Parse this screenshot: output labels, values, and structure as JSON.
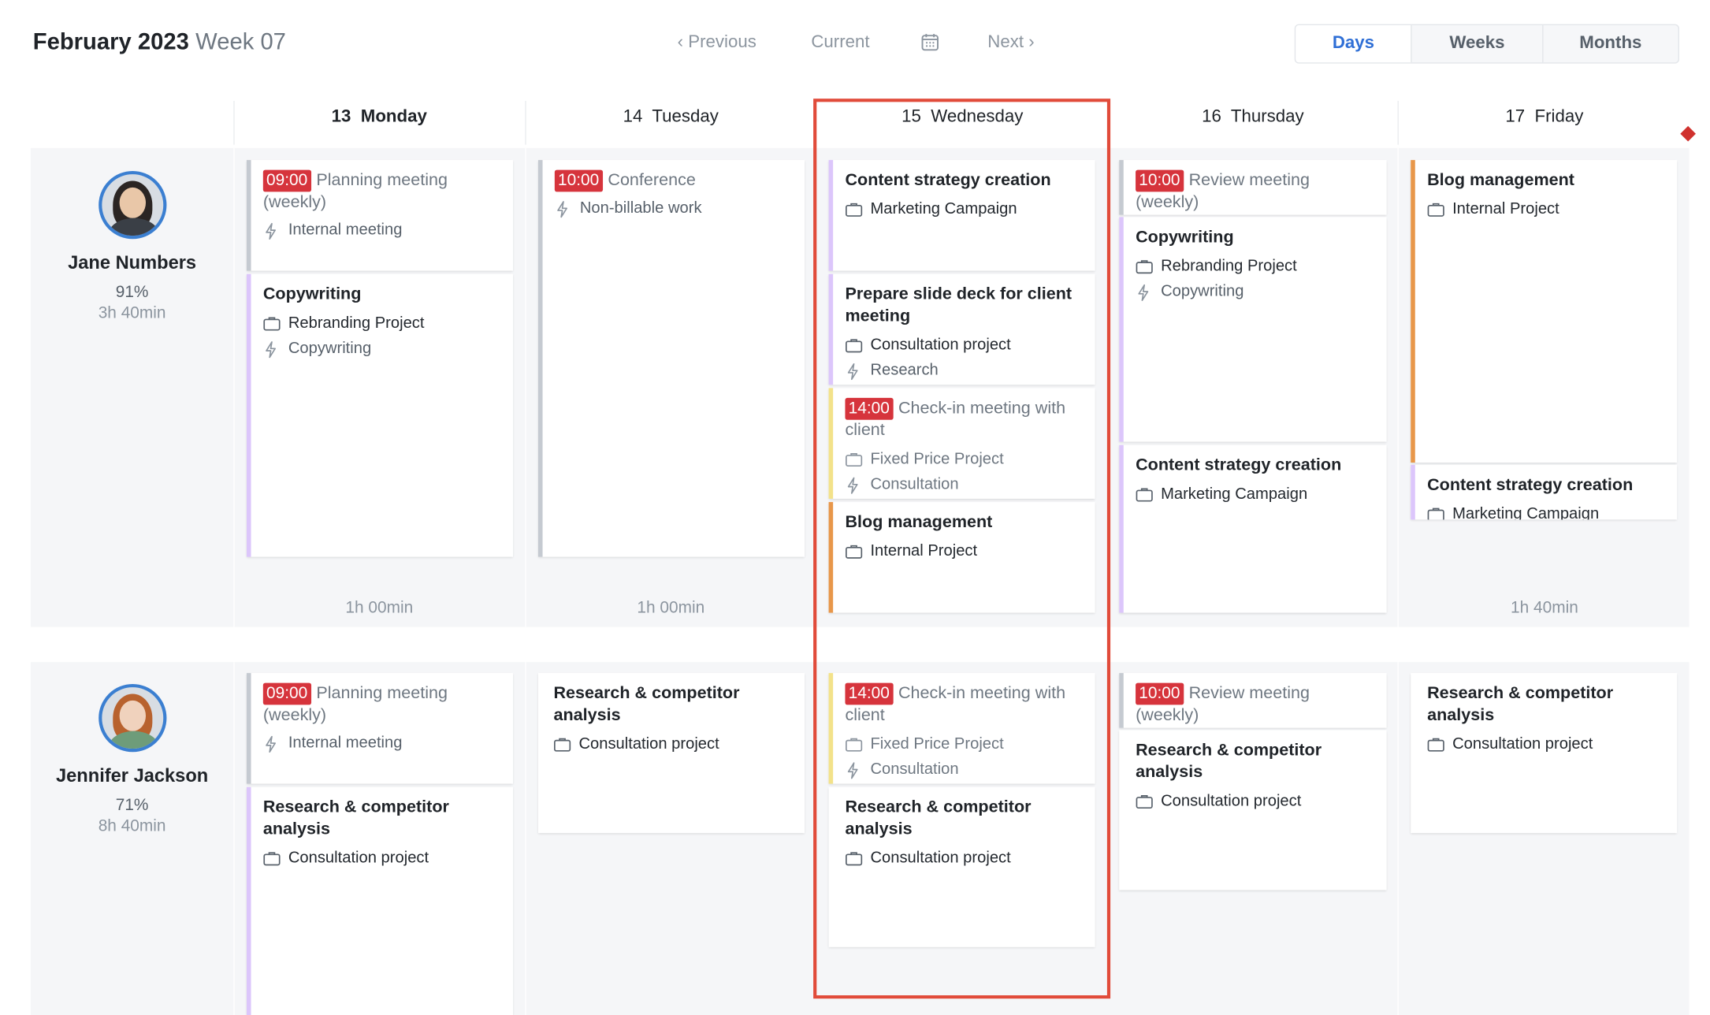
{
  "header": {
    "month": "February 2023",
    "week": "Week 07",
    "previous": "Previous",
    "current": "Current",
    "next": "Next",
    "views": {
      "days": "Days",
      "weeks": "Weeks",
      "months": "Months"
    }
  },
  "days": [
    {
      "num": "13",
      "name": "Monday"
    },
    {
      "num": "14",
      "name": "Tuesday"
    },
    {
      "num": "15",
      "name": "Wednesday"
    },
    {
      "num": "16",
      "name": "Thursday"
    },
    {
      "num": "17",
      "name": "Friday"
    }
  ],
  "people": [
    {
      "name": "Jane Numbers",
      "percent": "91%",
      "hours": "3h 40min",
      "totals": {
        "mon": "1h 00min",
        "tue": "1h 00min",
        "fri": "1h 40min"
      },
      "mon": [
        {
          "time": "09:00",
          "title": "Planning meeting (weekly)",
          "tag": "Internal meeting"
        },
        {
          "title": "Copywriting",
          "project": "Rebranding Project",
          "tag": "Copywriting"
        }
      ],
      "tue": [
        {
          "time": "10:00",
          "title": "Conference",
          "tag": "Non-billable work"
        }
      ],
      "wed": [
        {
          "title": "Content strategy creation",
          "project": "Marketing Campaign"
        },
        {
          "title": "Prepare slide deck for client meeting",
          "project": "Consultation project",
          "tag": "Research"
        },
        {
          "time": "14:00",
          "title": "Check-in meeting with client",
          "project": "Fixed Price Project",
          "tag": "Consultation"
        },
        {
          "title": "Blog management",
          "project": "Internal Project"
        }
      ],
      "thu": [
        {
          "time": "10:00",
          "title": "Review meeting (weekly)"
        },
        {
          "title": "Copywriting",
          "project": "Rebranding Project",
          "tag": "Copywriting"
        },
        {
          "title": "Content strategy creation",
          "project": "Marketing Campaign"
        }
      ],
      "fri": [
        {
          "title": "Blog management",
          "project": "Internal Project"
        },
        {
          "title": "Content strategy creation",
          "project": "Marketing Campaign"
        }
      ]
    },
    {
      "name": "Jennifer Jackson",
      "percent": "71%",
      "hours": "8h 40min",
      "mon": [
        {
          "time": "09:00",
          "title": "Planning meeting (weekly)",
          "tag": "Internal meeting"
        },
        {
          "title": "Research & competitor analysis",
          "project": "Consultation project"
        }
      ],
      "tue": [
        {
          "title": "Research & competitor analysis",
          "project": "Consultation project"
        }
      ],
      "wed": [
        {
          "time": "14:00",
          "title": "Check-in meeting with client",
          "project": "Fixed Price Project",
          "tag": "Consultation"
        },
        {
          "title": "Research & competitor analysis",
          "project": "Consultation project"
        }
      ],
      "thu": [
        {
          "time": "10:00",
          "title": "Review meeting (weekly)"
        },
        {
          "title": "Research & competitor analysis",
          "project": "Consultation project"
        }
      ],
      "fri": [
        {
          "title": "Research & competitor analysis",
          "project": "Consultation project"
        }
      ]
    }
  ],
  "colors": {
    "accent": "#2f6fd6",
    "time_badge": "#d6343c",
    "highlight": "#e14b3a"
  },
  "icons": {
    "project": "briefcase-icon",
    "tag": "bolt-icon",
    "calendar": "calendar-icon"
  }
}
